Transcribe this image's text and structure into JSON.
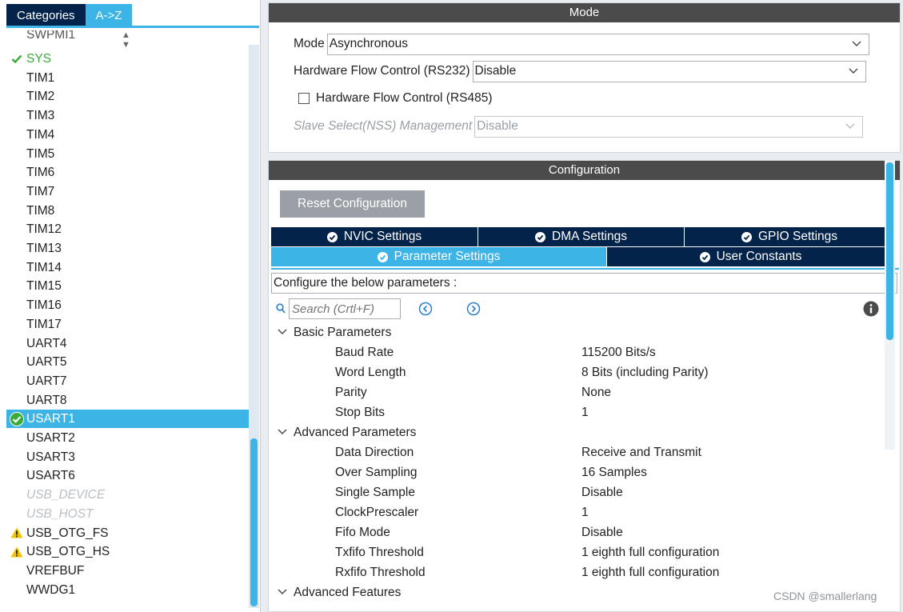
{
  "left_tabs": [
    "Categories",
    "A->Z"
  ],
  "left_list": [
    {
      "label": "SWPMI1",
      "state": "cut"
    },
    {
      "label": "SYS",
      "state": "ok"
    },
    {
      "label": "TIM1",
      "state": "normal"
    },
    {
      "label": "TIM2",
      "state": "normal"
    },
    {
      "label": "TIM3",
      "state": "normal"
    },
    {
      "label": "TIM4",
      "state": "normal"
    },
    {
      "label": "TIM5",
      "state": "normal"
    },
    {
      "label": "TIM6",
      "state": "normal"
    },
    {
      "label": "TIM7",
      "state": "normal"
    },
    {
      "label": "TIM8",
      "state": "normal"
    },
    {
      "label": "TIM12",
      "state": "normal"
    },
    {
      "label": "TIM13",
      "state": "normal"
    },
    {
      "label": "TIM14",
      "state": "normal"
    },
    {
      "label": "TIM15",
      "state": "normal"
    },
    {
      "label": "TIM16",
      "state": "normal"
    },
    {
      "label": "TIM17",
      "state": "normal"
    },
    {
      "label": "UART4",
      "state": "normal"
    },
    {
      "label": "UART5",
      "state": "normal"
    },
    {
      "label": "UART7",
      "state": "normal"
    },
    {
      "label": "UART8",
      "state": "normal"
    },
    {
      "label": "USART1",
      "state": "selected"
    },
    {
      "label": "USART2",
      "state": "normal"
    },
    {
      "label": "USART3",
      "state": "normal"
    },
    {
      "label": "USART6",
      "state": "normal"
    },
    {
      "label": "USB_DEVICE",
      "state": "disabled"
    },
    {
      "label": "USB_HOST",
      "state": "disabled"
    },
    {
      "label": "USB_OTG_FS",
      "state": "warning"
    },
    {
      "label": "USB_OTG_HS",
      "state": "warning"
    },
    {
      "label": "VREFBUF",
      "state": "normal"
    },
    {
      "label": "WWDG1",
      "state": "normal"
    }
  ],
  "mode": {
    "title": "Mode",
    "mode_label": "Mode",
    "mode_value": "Asynchronous",
    "hfc232_label": "Hardware Flow Control (RS232)",
    "hfc232_value": "Disable",
    "hfc485_label": "Hardware Flow Control (RS485)",
    "nss_label": "Slave Select(NSS) Management",
    "nss_value": "Disable"
  },
  "configuration": {
    "title": "Configuration",
    "reset_label": "Reset Configuration",
    "tabs_row1": [
      "NVIC Settings",
      "DMA Settings",
      "GPIO Settings"
    ],
    "tabs_row2": [
      "Parameter Settings",
      "User Constants"
    ],
    "configure_text": "Configure the below parameters :",
    "search_placeholder": "Search (Crtl+F)"
  },
  "params": [
    {
      "group": "Basic Parameters"
    },
    {
      "name": "Baud Rate",
      "value": "115200 Bits/s"
    },
    {
      "name": "Word Length",
      "value": "8 Bits (including Parity)"
    },
    {
      "name": "Parity",
      "value": "None"
    },
    {
      "name": "Stop Bits",
      "value": "1"
    },
    {
      "group": "Advanced Parameters"
    },
    {
      "name": "Data Direction",
      "value": "Receive and Transmit"
    },
    {
      "name": "Over Sampling",
      "value": "16 Samples"
    },
    {
      "name": "Single Sample",
      "value": "Disable"
    },
    {
      "name": "ClockPrescaler",
      "value": "1"
    },
    {
      "name": "Fifo Mode",
      "value": "Disable"
    },
    {
      "name": "Txfifo Threshold",
      "value": "1 eighth full configuration"
    },
    {
      "name": "Rxfifo Threshold",
      "value": "1 eighth full configuration"
    },
    {
      "group": "Advanced Features"
    }
  ],
  "watermark": "CSDN @smallerlang",
  "colors": {
    "accent": "#3cb4e6",
    "navy": "#03234b",
    "ok": "#3aab39",
    "warning": "#f2c300",
    "header": "#4b4b4b"
  }
}
